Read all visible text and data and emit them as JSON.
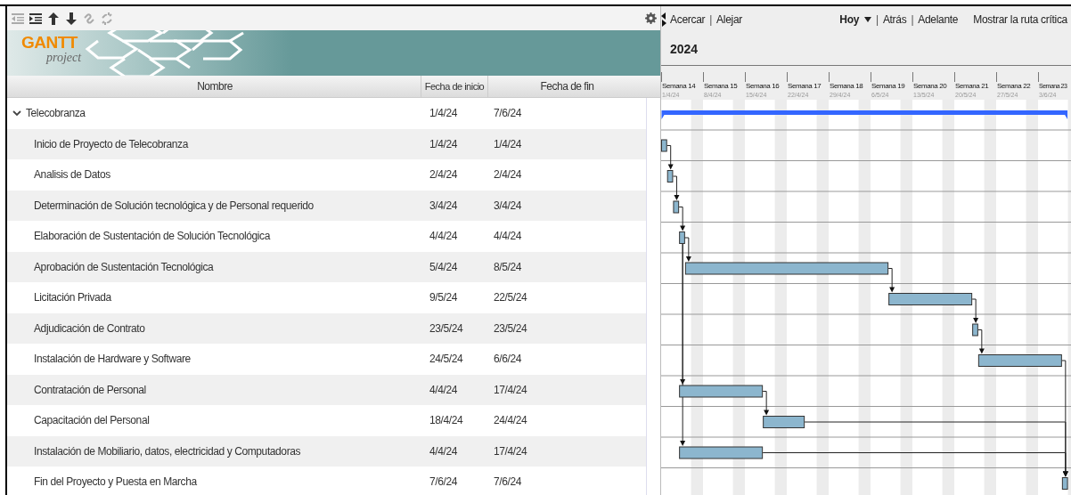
{
  "toolbar": [
    {
      "kind": "outdent",
      "disabled": true
    },
    {
      "kind": "indent",
      "disabled": false
    },
    {
      "kind": "up",
      "disabled": false
    },
    {
      "kind": "down",
      "disabled": false
    },
    {
      "kind": "link",
      "disabled": true
    },
    {
      "kind": "unlink",
      "disabled": true
    }
  ],
  "logo": {
    "name": "GANTT",
    "tagline": "project"
  },
  "columns": [
    {
      "label": "Nombre"
    },
    {
      "label": "Fecha de inicio"
    },
    {
      "label": "Fecha de fin"
    }
  ],
  "tasks": [
    {
      "name": "Telecobranza",
      "start": "1/4/24",
      "end": "7/6/24",
      "expanded": true,
      "children": [
        {
          "name": "Inicio de Proyecto de Telecobranza",
          "start": "1/4/24",
          "end": "1/4/24"
        },
        {
          "name": "Analisis de Datos",
          "start": "2/4/24",
          "end": "2/4/24"
        },
        {
          "name": "Determinación de Solución tecnológica y de Personal requerido",
          "start": "3/4/24",
          "end": "3/4/24"
        },
        {
          "name": "Elaboración de Sustentación de Solución Tecnológica",
          "start": "4/4/24",
          "end": "4/4/24"
        },
        {
          "name": "Aprobación de Sustentación Tecnológica",
          "start": "5/4/24",
          "end": "8/5/24"
        },
        {
          "name": "Licitación Privada",
          "start": "9/5/24",
          "end": "22/5/24"
        },
        {
          "name": "Adjudicación de Contrato",
          "start": "23/5/24",
          "end": "23/5/24"
        },
        {
          "name": "Instalación de Hardware y Software",
          "start": "24/5/24",
          "end": "6/6/24"
        },
        {
          "name": "Contratación de Personal",
          "start": "4/4/24",
          "end": "17/4/24"
        },
        {
          "name": "Capacitación del Personal",
          "start": "18/4/24",
          "end": "24/4/24"
        },
        {
          "name": "Instalación de Mobiliario, datos, electricidad y Computadoras",
          "start": "4/4/24",
          "end": "17/4/24"
        },
        {
          "name": "Fin del Proyecto y Puesta en Marcha",
          "start": "7/6/24",
          "end": "7/6/24"
        }
      ]
    }
  ],
  "chart_toolbar": {
    "left": [
      {
        "kind": "link",
        "label": "Acercar"
      },
      {
        "kind": "separator",
        "label": "|"
      },
      {
        "kind": "link",
        "label": "Alejar"
      }
    ],
    "right": [
      {
        "kind": "dropdown",
        "label": "Hoy"
      },
      {
        "kind": "separator",
        "label": "|"
      },
      {
        "kind": "link",
        "label": "Atrás"
      },
      {
        "kind": "separator",
        "label": "|"
      },
      {
        "kind": "link",
        "label": "Adelante"
      },
      {
        "kind": "button",
        "label": "Mostrar la ruta crítica"
      }
    ]
  },
  "year": "2024",
  "weeks": [
    {
      "label": "Semana 14",
      "date": "1/4/24"
    },
    {
      "label": "Semana 15",
      "date": "8/4/24"
    },
    {
      "label": "Semana 16",
      "date": "15/4/24"
    },
    {
      "label": "Semana 17",
      "date": "22/4/24"
    },
    {
      "label": "Semana 18",
      "date": "29/4/24"
    },
    {
      "label": "Semana 19",
      "date": "6/5/24"
    },
    {
      "label": "Semana 20",
      "date": "13/5/24"
    },
    {
      "label": "Semana 21",
      "date": "20/5/24"
    },
    {
      "label": "Semana 22",
      "date": "27/5/24"
    },
    {
      "label": "Semana 23",
      "date": "3/6/24"
    }
  ]
}
